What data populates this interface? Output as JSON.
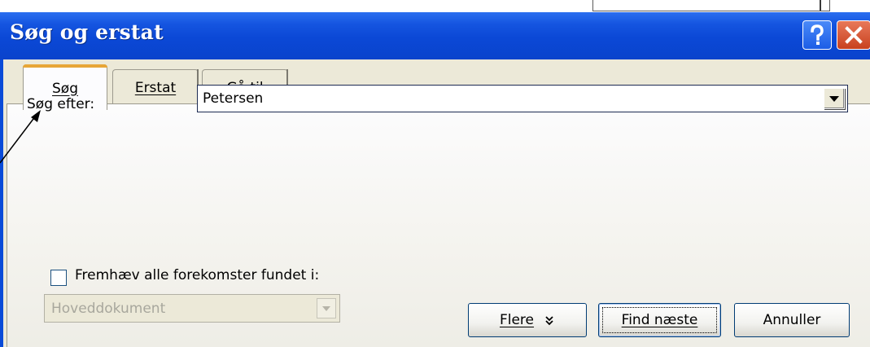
{
  "window": {
    "title": "Søg og erstat"
  },
  "titlebar_buttons": {
    "help_icon": "question-mark",
    "close_icon": "x-mark"
  },
  "tabs": [
    {
      "label": "Søg",
      "active": true
    },
    {
      "label": "Erstat",
      "active": false
    },
    {
      "label": "Gå til",
      "active": false
    }
  ],
  "search": {
    "label": "Søg efter:",
    "value": "Petersen"
  },
  "highlight": {
    "label": "Fremhæv alle forekomster fundet i:",
    "checked": false,
    "scope_value": "Hoveddokument",
    "scope_enabled": false
  },
  "buttons": {
    "more": "Flere",
    "more_icon": "double-chevron-down",
    "find_next": "Find næste",
    "cancel": "Annuller"
  },
  "colors": {
    "titlebar": "#0a4bd8",
    "client_background": "#ece9d8",
    "active_tab_accent": "#e7a637",
    "close_button": "#c8411f"
  }
}
